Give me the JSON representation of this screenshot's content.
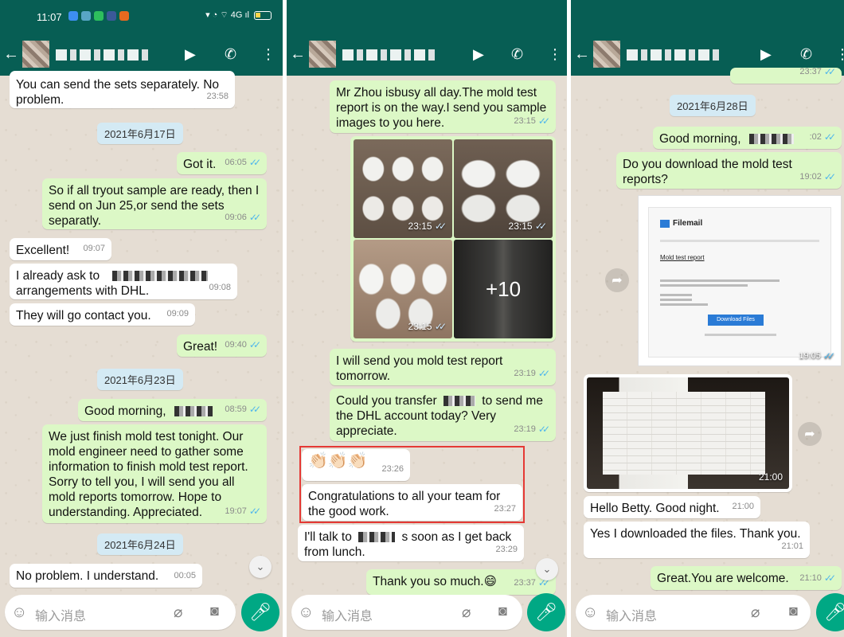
{
  "status_time": "11:07",
  "colors": {
    "header": "#075e54",
    "incoming": "#ffffff",
    "outgoing": "#dcf8c6",
    "accent": "#00a884",
    "ticks": "#4fb6ec",
    "highlight": "#e53935"
  },
  "input_placeholder": "输入消息",
  "icons": [
    "back-arrow-icon",
    "video-call-icon",
    "phone-icon",
    "more-vert-icon",
    "emoji-icon",
    "attach-icon",
    "camera-icon",
    "mic-icon",
    "forward-icon",
    "chevron-down-icon",
    "double-tick-icon"
  ],
  "p1": {
    "m0": {
      "text": "You can send the sets separately. No problem.",
      "time": "23:58"
    },
    "d1": "2021年6月17日",
    "m1": {
      "text": "Got it.",
      "time": "06:05"
    },
    "m2": {
      "text": "So if all tryout sample are ready, then I send on Jun 25,or send the sets separatly.",
      "time": "09:06"
    },
    "m3": {
      "text": "Excellent!",
      "time": "09:07"
    },
    "m4a": {
      "text": "I already ask to"
    },
    "m4b": {
      "text": "arrangements with DHL.",
      "time": "09:08"
    },
    "m5": {
      "text": "They will go contact you.",
      "time": "09:09"
    },
    "m6": {
      "text": "Great!",
      "time": "09:40"
    },
    "d2": "2021年6月23日",
    "m7": {
      "text": "Good morning,",
      "time": "08:59"
    },
    "m8": {
      "text": "We just finish mold test tonight. Our mold engineer need to gather some information to finish mold test report. Sorry to tell you, I will send you all mold reports tomorrow. Hope to understanding. Appreciated.",
      "time": "19:07"
    },
    "d3": "2021年6月24日",
    "m9": {
      "text": "No problem. I understand.",
      "time": "00:05"
    }
  },
  "p2": {
    "m1": {
      "text": "Mr Zhou isbusy all day.The mold test report is on the way.I send you sample images to you here.",
      "time": "23:15"
    },
    "photos": [
      "23:15",
      "23:15",
      "23:15"
    ],
    "more": "+10",
    "m2": {
      "text": "I will send you mold test report tomorrow.",
      "time": "23:19"
    },
    "m3a": {
      "text": "Could you transfer"
    },
    "m3b": {
      "text": "to send me the DHL account today? Very appreciate.",
      "time": "23:19"
    },
    "m4": {
      "text": "👏🏻👏🏻👏🏻",
      "time": "23:26"
    },
    "m5": {
      "text": "Congratulations to all your team for the good work.",
      "time": "23:27"
    },
    "m6a": {
      "text": "I'll talk to"
    },
    "m6b": {
      "text": "s soon as I get back from lunch.",
      "time": "23:29"
    },
    "m7": {
      "text": "Thank you so much.😄",
      "time": "23:37"
    }
  },
  "p3": {
    "m0": {
      "time": "23:37"
    },
    "d1": "2021年6月28日",
    "m1": {
      "text": "Good morning,",
      "time": ":02"
    },
    "m2": {
      "text": "Do you download the mold test reports?",
      "time": "19:02"
    },
    "doc": {
      "logo": "Filemail",
      "title": "Mold test report",
      "button": "Download Files",
      "time": "19:05"
    },
    "photo_time": "21:00",
    "m3": {
      "text": "Hello Betty. Good night.",
      "time": "21:00"
    },
    "m4": {
      "text": "Yes I downloaded the files. Thank you.",
      "time": "21:01"
    },
    "m5": {
      "text": "Great.You are welcome.",
      "time": "21:10"
    }
  }
}
